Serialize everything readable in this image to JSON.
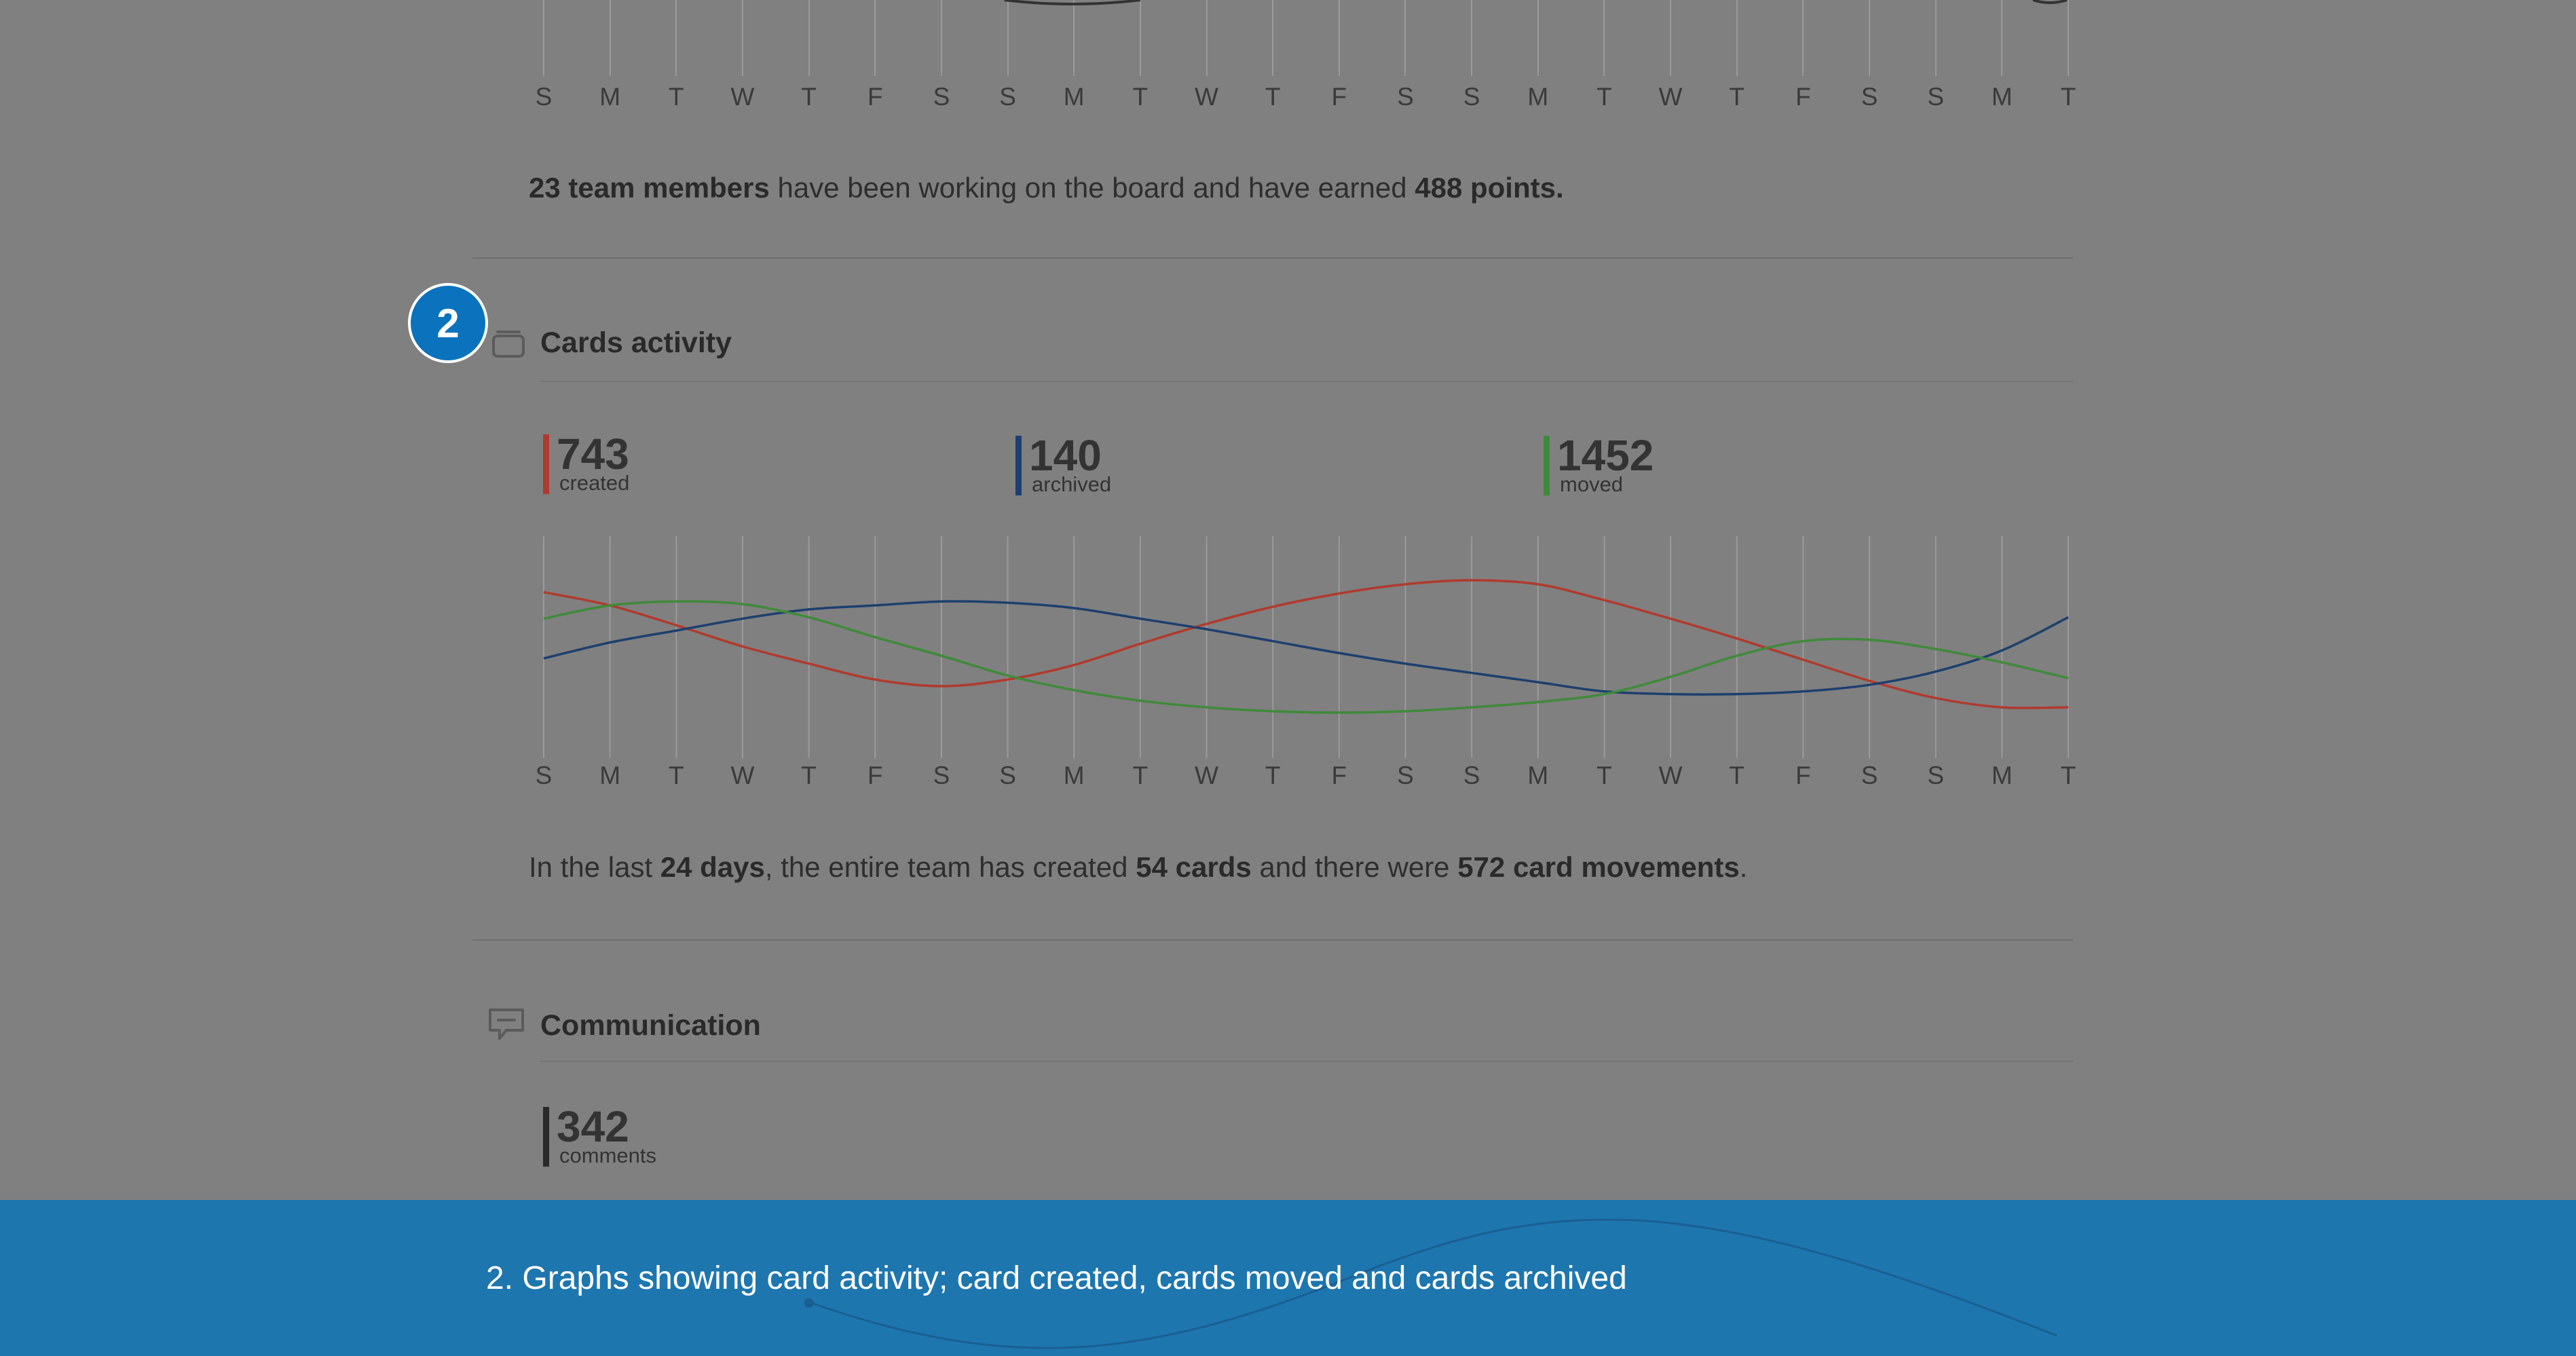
{
  "days": [
    "S",
    "M",
    "T",
    "W",
    "T",
    "F",
    "S",
    "S",
    "M",
    "T",
    "W",
    "T",
    "F",
    "S",
    "S",
    "M",
    "T",
    "W",
    "T",
    "F",
    "S",
    "S",
    "M",
    "T"
  ],
  "members_summary": {
    "members": "23 team members",
    "middle": " have been working on the board and have earned ",
    "points": "488 points."
  },
  "cards_activity": {
    "title": "Cards activity",
    "badge": "2",
    "stats": [
      {
        "value": "743",
        "label": "created",
        "color": "#b03a2e"
      },
      {
        "value": "140",
        "label": "archived",
        "color": "#1d3f6e"
      },
      {
        "value": "1452",
        "label": "moved",
        "color": "#3f8a3a"
      }
    ],
    "summary": {
      "p1": "In the last ",
      "days": "24 days",
      "p2": ", the entire team has created ",
      "cards": "54 cards",
      "p3": " and there were ",
      "movements": "572 card movements",
      "p4": "."
    }
  },
  "chart_data": {
    "type": "line",
    "x": [
      "S",
      "M",
      "T",
      "W",
      "T",
      "F",
      "S",
      "S",
      "M",
      "T",
      "W",
      "T",
      "F",
      "S",
      "S",
      "M",
      "T",
      "W",
      "T",
      "F",
      "S",
      "S",
      "M",
      "T"
    ],
    "series": [
      {
        "name": "created",
        "color": "#b03a2e",
        "values": [
          0.91,
          0.81,
          0.66,
          0.5,
          0.37,
          0.25,
          0.2,
          0.25,
          0.36,
          0.52,
          0.67,
          0.8,
          0.9,
          0.97,
          1.0,
          0.97,
          0.85,
          0.71,
          0.56,
          0.4,
          0.24,
          0.11,
          0.04,
          0.04
        ]
      },
      {
        "name": "archived",
        "color": "#1d3f6e",
        "values": [
          0.41,
          0.53,
          0.62,
          0.71,
          0.78,
          0.81,
          0.84,
          0.83,
          0.79,
          0.71,
          0.63,
          0.54,
          0.45,
          0.37,
          0.3,
          0.23,
          0.16,
          0.14,
          0.14,
          0.16,
          0.21,
          0.31,
          0.47,
          0.72
        ]
      },
      {
        "name": "moved",
        "color": "#3f8a3a",
        "values": [
          0.71,
          0.81,
          0.84,
          0.82,
          0.72,
          0.57,
          0.43,
          0.28,
          0.17,
          0.09,
          0.04,
          0.01,
          0.0,
          0.01,
          0.04,
          0.08,
          0.14,
          0.27,
          0.43,
          0.54,
          0.55,
          0.48,
          0.38,
          0.26
        ]
      }
    ]
  },
  "communication": {
    "title": "Communication",
    "stat": {
      "value": "342",
      "label": "comments",
      "color": "#2a2a2a"
    }
  },
  "caption": "2. Graphs showing card activity; card created, cards moved and cards archived"
}
